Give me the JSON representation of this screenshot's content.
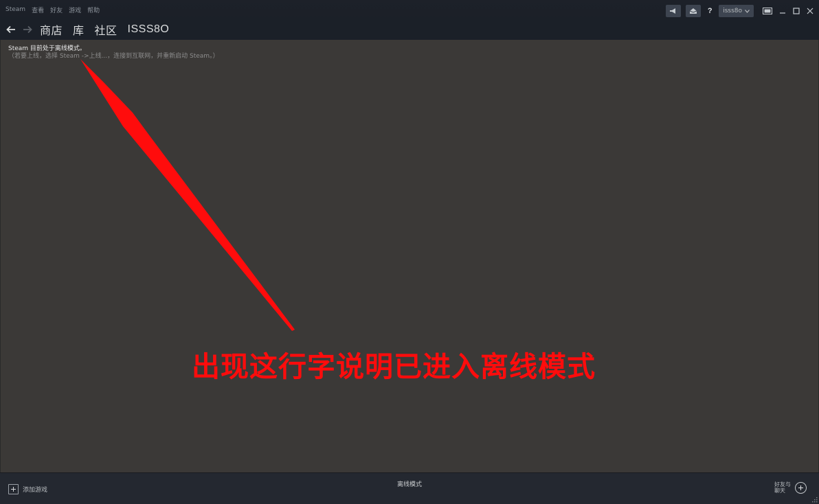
{
  "menu": {
    "items": [
      "Steam",
      "查看",
      "好友",
      "游戏",
      "帮助"
    ]
  },
  "titlebar": {
    "username": "isss8o",
    "icons": [
      "announcement-icon",
      "notification-icon",
      "help-icon",
      "big-picture-icon",
      "minimize-icon",
      "maximize-icon",
      "close-icon"
    ],
    "help_glyph": "?"
  },
  "nav": {
    "tabs": [
      "商店",
      "库",
      "社区",
      "ISSS8O"
    ]
  },
  "main": {
    "offline_title": "Steam 目前处于离线模式。",
    "offline_hint": "（若要上线，选择 Steam ->上线...，连接到互联网，并重新启动 Steam。）",
    "annotation": "出现这行字说明已进入离线模式",
    "annotation_color": "#ff0c0c"
  },
  "bottom": {
    "add_game": "添加游戏",
    "mode": "离线模式",
    "friends_line1": "好友与",
    "friends_line2": "聊天"
  },
  "colors": {
    "background": "#3b3937",
    "titlebar": "#1b2028",
    "bottombar": "#242830"
  }
}
